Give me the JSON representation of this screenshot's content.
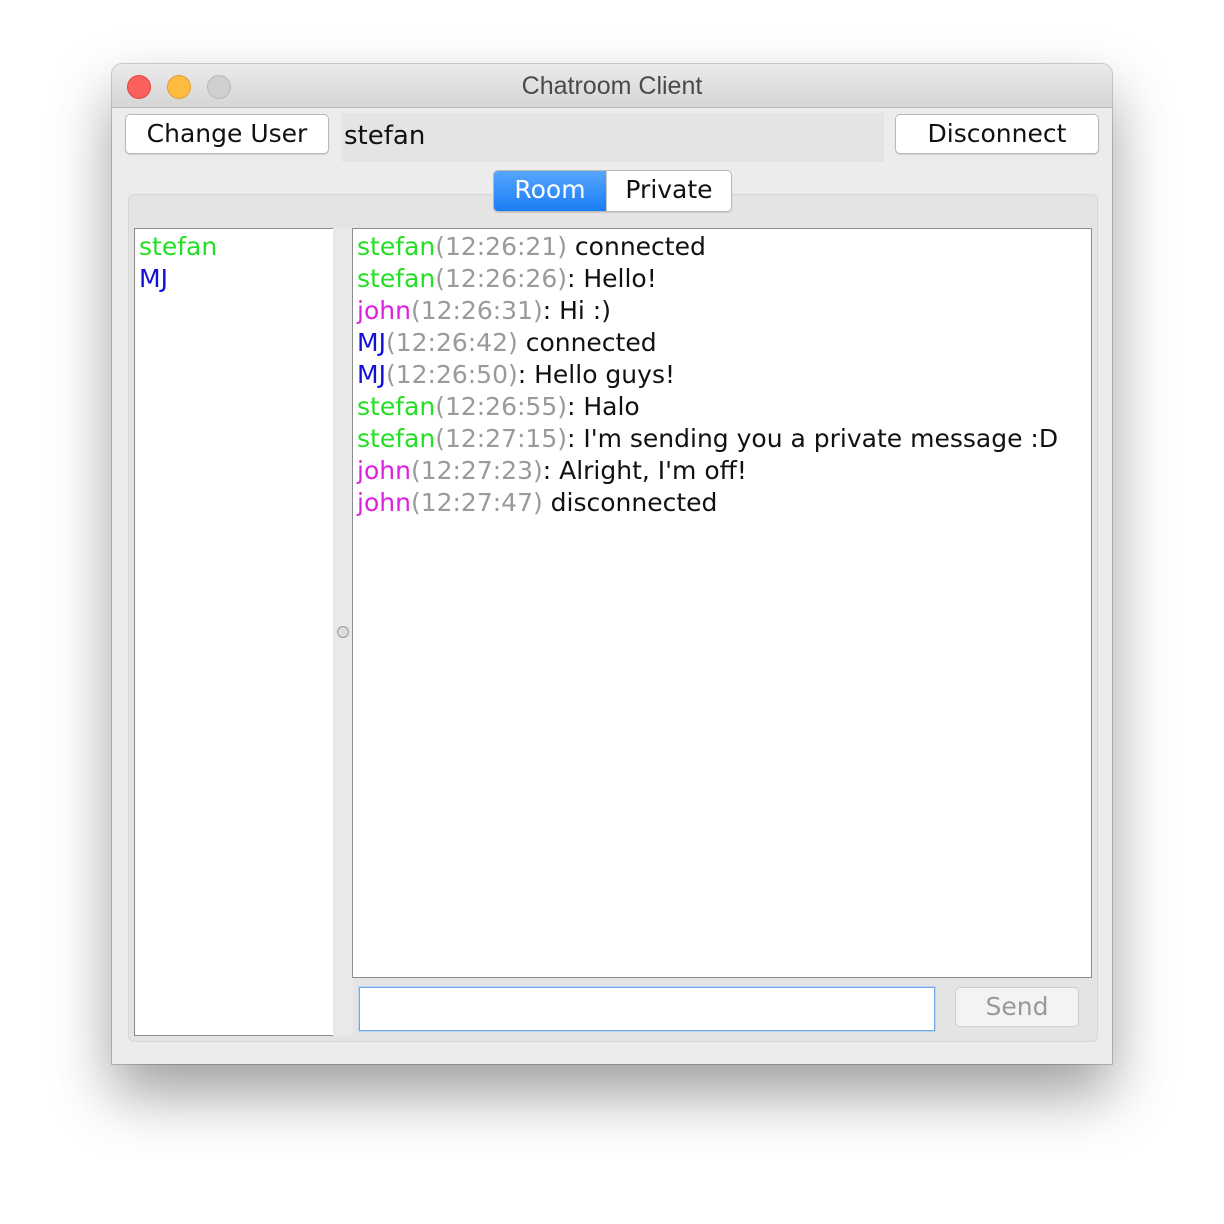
{
  "window": {
    "title": "Chatroom Client"
  },
  "toolbar": {
    "change_user_label": "Change User",
    "current_user": "stefan",
    "disconnect_label": "Disconnect"
  },
  "tabs": [
    {
      "label": "Room",
      "selected": true
    },
    {
      "label": "Private",
      "selected": false
    }
  ],
  "users": [
    {
      "name": "stefan",
      "color": "#22e022"
    },
    {
      "name": "MJ",
      "color": "#1010d8"
    }
  ],
  "messages": [
    {
      "user": "stefan",
      "color": "#22e022",
      "time": "(12:26:21)",
      "text": " connected"
    },
    {
      "user": "stefan",
      "color": "#22e022",
      "time": "(12:26:26)",
      "text": ": Hello!"
    },
    {
      "user": "john",
      "color": "#e020e0",
      "time": "(12:26:31)",
      "text": ": Hi :)"
    },
    {
      "user": "MJ",
      "color": "#1010d8",
      "time": "(12:26:42)",
      "text": " connected"
    },
    {
      "user": "MJ",
      "color": "#1010d8",
      "time": "(12:26:50)",
      "text": ": Hello guys!"
    },
    {
      "user": "stefan",
      "color": "#22e022",
      "time": "(12:26:55)",
      "text": ": Halo"
    },
    {
      "user": "stefan",
      "color": "#22e022",
      "time": "(12:27:15)",
      "text": ": I'm sending you a private message :D"
    },
    {
      "user": "john",
      "color": "#e020e0",
      "time": "(12:27:23)",
      "text": ": Alright, I'm off!"
    },
    {
      "user": "john",
      "color": "#e020e0",
      "time": "(12:27:47)",
      "text": " disconnected"
    }
  ],
  "composer": {
    "input_value": "",
    "send_label": "Send",
    "send_enabled": false
  },
  "colors": {
    "accent": "#1a7df5",
    "timestamp": "#9a9a9a"
  }
}
